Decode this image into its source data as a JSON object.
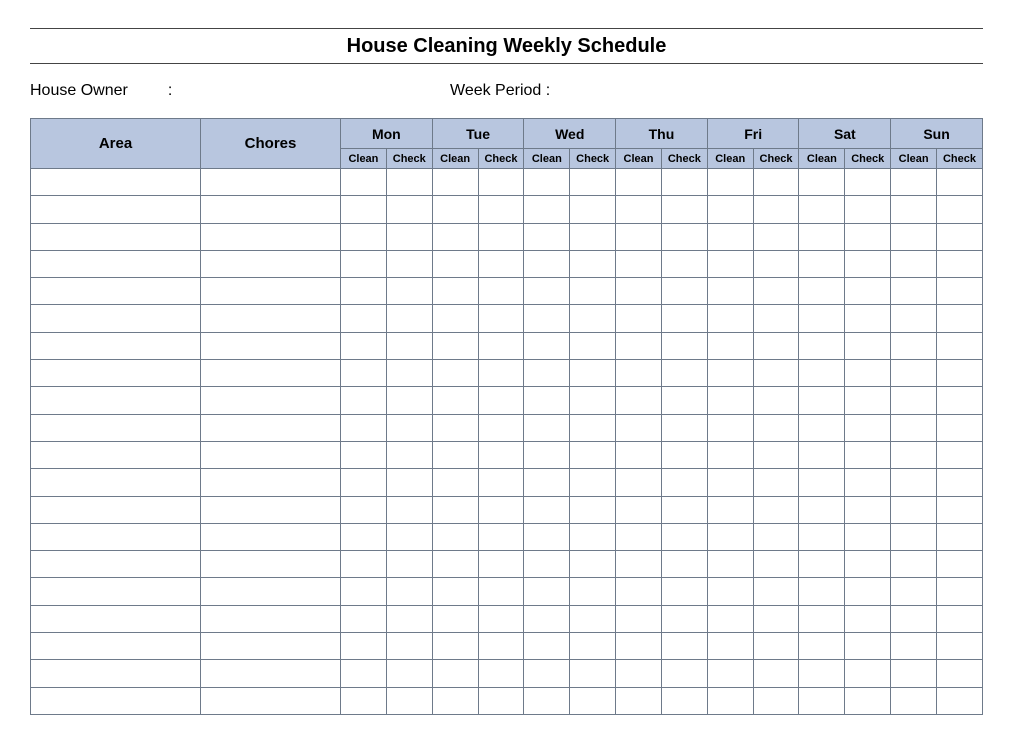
{
  "title": "House Cleaning Weekly Schedule",
  "meta": {
    "owner_label": "House Owner",
    "owner_sep": ":",
    "week_label": "Week  Period :"
  },
  "headers": {
    "area": "Area",
    "chores": "Chores",
    "days": [
      "Mon",
      "Tue",
      "Wed",
      "Thu",
      "Fri",
      "Sat",
      "Sun"
    ],
    "sub": [
      "Clean",
      "Check"
    ]
  },
  "row_count": 20,
  "colors": {
    "header_bg": "#b8c6df",
    "border": "#6e7a8a"
  },
  "chart_data": {
    "type": "table",
    "title": "House Cleaning Weekly Schedule",
    "columns": [
      "Area",
      "Chores",
      "Mon Clean",
      "Mon Check",
      "Tue Clean",
      "Tue Check",
      "Wed Clean",
      "Wed Check",
      "Thu Clean",
      "Thu Check",
      "Fri Clean",
      "Fri Check",
      "Sat Clean",
      "Sat Check",
      "Sun Clean",
      "Sun Check"
    ],
    "rows": []
  }
}
